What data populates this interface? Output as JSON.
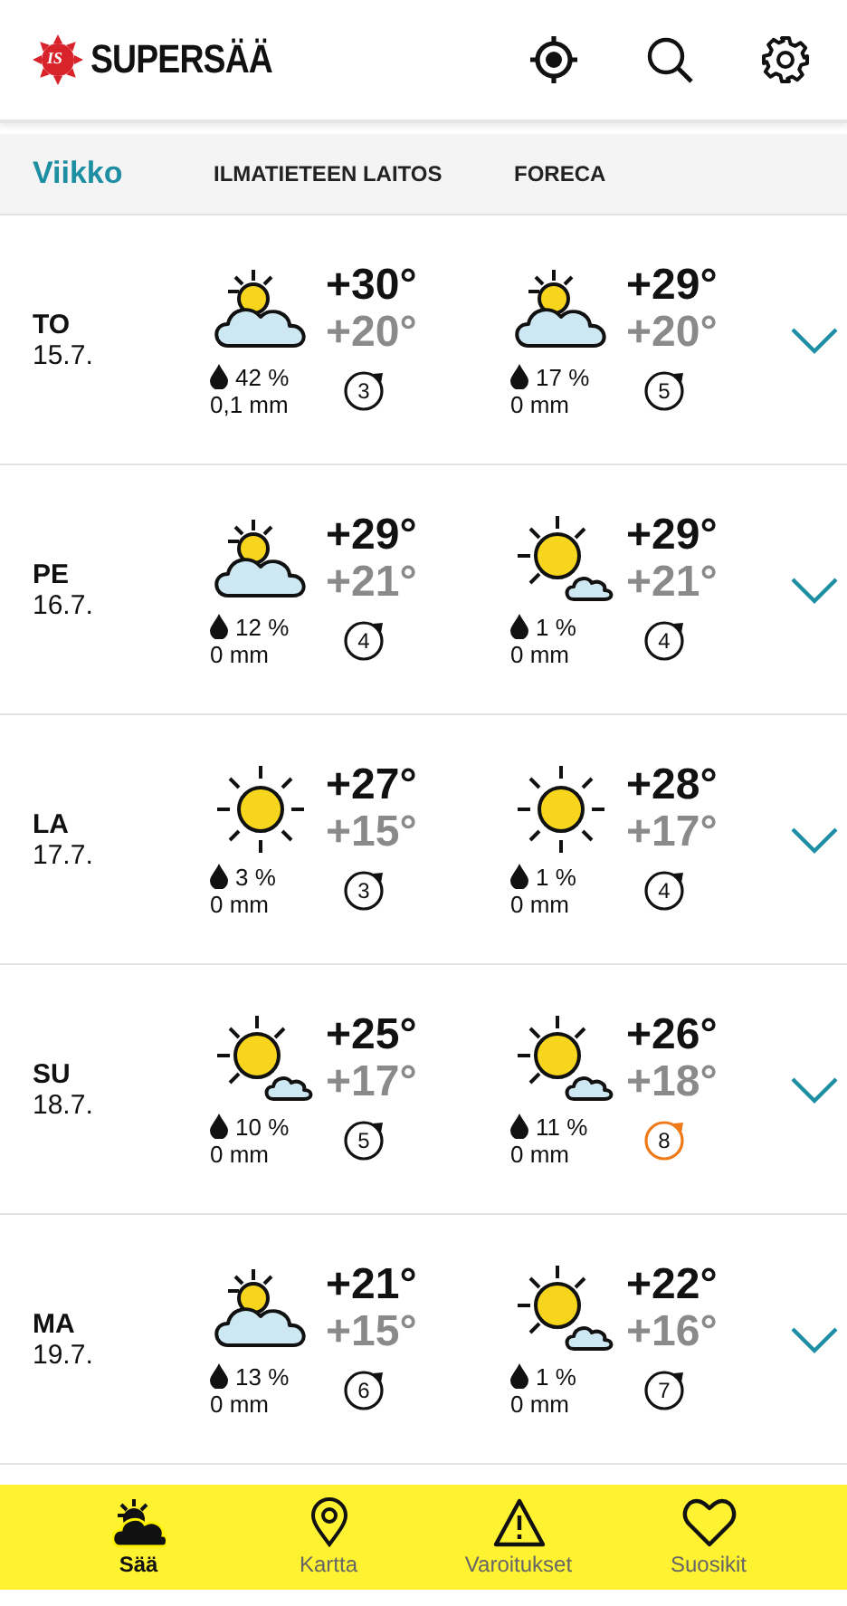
{
  "app": {
    "logo_badge": "IS",
    "title": "SUPERSÄÄ"
  },
  "tabs": [
    {
      "label": "Viikko",
      "selected": true
    },
    {
      "label": "ILMATIETEEN LAITOS",
      "selected": false
    },
    {
      "label": "FORECA",
      "selected": false
    }
  ],
  "days": [
    {
      "weekday": "TO",
      "date": "15.7.",
      "expanded": false,
      "forecasts": [
        {
          "kind": "cloudy",
          "high": "+30°",
          "low": "+20°",
          "rain_chance": "42 %",
          "rain_amount": "0,1 mm",
          "wind": "3",
          "strong": false
        },
        {
          "kind": "cloudy",
          "high": "+29°",
          "low": "+20°",
          "rain_chance": "17 %",
          "rain_amount": "0 mm",
          "wind": "5",
          "strong": false
        }
      ]
    },
    {
      "weekday": "PE",
      "date": "16.7.",
      "expanded": false,
      "forecasts": [
        {
          "kind": "cloudy",
          "high": "+29°",
          "low": "+21°",
          "rain_chance": "12 %",
          "rain_amount": "0 mm",
          "wind": "4",
          "strong": false
        },
        {
          "kind": "partly",
          "high": "+29°",
          "low": "+21°",
          "rain_chance": "1 %",
          "rain_amount": "0 mm",
          "wind": "4",
          "strong": false
        }
      ]
    },
    {
      "weekday": "LA",
      "date": "17.7.",
      "expanded": false,
      "forecasts": [
        {
          "kind": "sunny",
          "high": "+27°",
          "low": "+15°",
          "rain_chance": "3 %",
          "rain_amount": "0 mm",
          "wind": "3",
          "strong": false
        },
        {
          "kind": "sunny",
          "high": "+28°",
          "low": "+17°",
          "rain_chance": "1 %",
          "rain_amount": "0 mm",
          "wind": "4",
          "strong": false
        }
      ]
    },
    {
      "weekday": "SU",
      "date": "18.7.",
      "expanded": false,
      "forecasts": [
        {
          "kind": "partly",
          "high": "+25°",
          "low": "+17°",
          "rain_chance": "10 %",
          "rain_amount": "0 mm",
          "wind": "5",
          "strong": false
        },
        {
          "kind": "partly",
          "high": "+26°",
          "low": "+18°",
          "rain_chance": "11 %",
          "rain_amount": "0 mm",
          "wind": "8",
          "strong": true
        }
      ]
    },
    {
      "weekday": "MA",
      "date": "19.7.",
      "expanded": false,
      "forecasts": [
        {
          "kind": "cloudy",
          "high": "+21°",
          "low": "+15°",
          "rain_chance": "13 %",
          "rain_amount": "0 mm",
          "wind": "6",
          "strong": false
        },
        {
          "kind": "partly",
          "high": "+22°",
          "low": "+16°",
          "rain_chance": "1 %",
          "rain_amount": "0 mm",
          "wind": "7",
          "strong": false
        }
      ]
    }
  ],
  "nav": [
    {
      "kind": "weather",
      "label": "Sää",
      "selected": true
    },
    {
      "kind": "map",
      "label": "Kartta",
      "selected": false
    },
    {
      "kind": "warning",
      "label": "Varoitukset",
      "selected": false
    },
    {
      "kind": "favorite",
      "label": "Suosikit",
      "selected": false
    }
  ]
}
